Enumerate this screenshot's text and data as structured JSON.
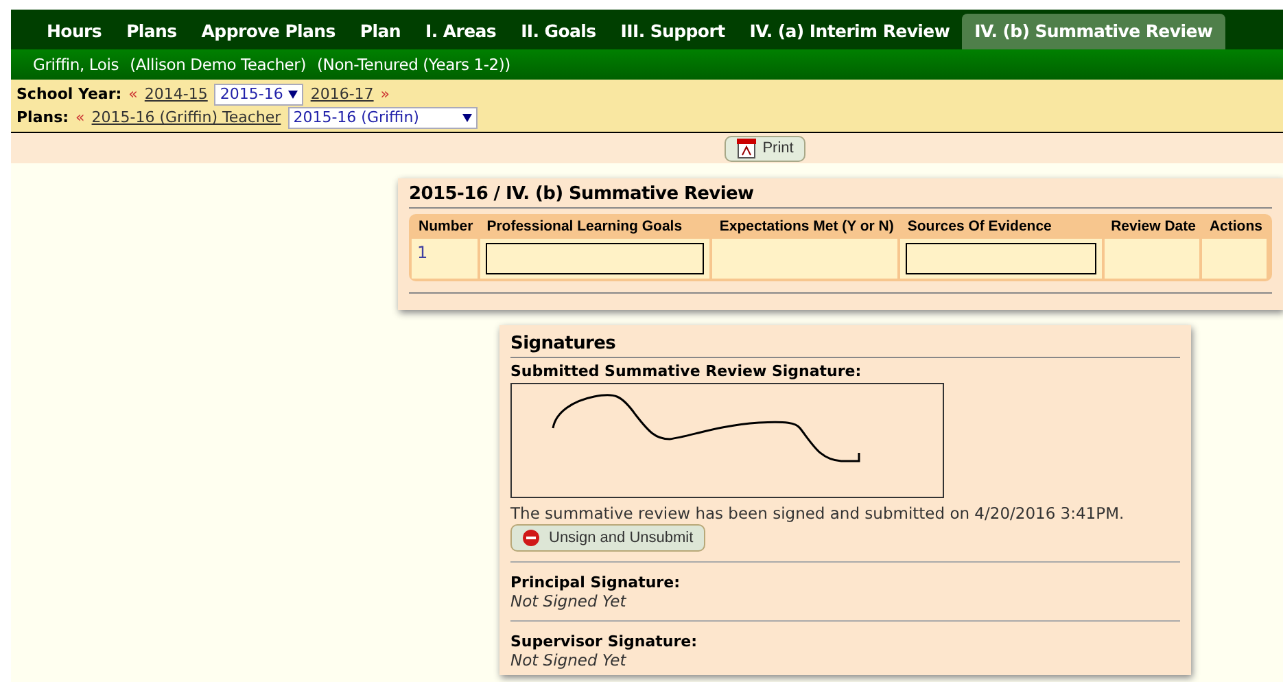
{
  "nav_tabs": [
    {
      "label": "Hours",
      "selected": false
    },
    {
      "label": "Plans",
      "selected": false
    },
    {
      "label": "Approve Plans",
      "selected": false
    },
    {
      "label": "Plan",
      "selected": false
    },
    {
      "label": "I. Areas",
      "selected": false
    },
    {
      "label": "II. Goals",
      "selected": false
    },
    {
      "label": "III. Support",
      "selected": false
    },
    {
      "label": "IV. (a) Interim Review",
      "selected": false
    },
    {
      "label": "IV. (b) Summative Review",
      "selected": true
    }
  ],
  "teacher_bar": {
    "name": "Griffin, Lois",
    "role": "(Allison Demo Teacher)",
    "status": "(Non-Tenured (Years 1-2))"
  },
  "school_year": {
    "label": "School Year:",
    "prev_arrow": "«",
    "prev": "2014-15",
    "select_value": "2015-16",
    "next": "2016-17",
    "next_arrow": "»"
  },
  "plans": {
    "label": "Plans:",
    "prev_arrow": "«",
    "prev": "2015-16 (Griffin) Teacher",
    "select_value": "2015-16 (Griffin)"
  },
  "print_button": "Print",
  "review": {
    "title": "2015-16 / IV. (b) Summative Review",
    "columns": [
      "Number",
      "Professional Learning Goals",
      "Expectations Met (Y or N)",
      "Sources Of Evidence",
      "Review Date",
      "Actions"
    ],
    "rows": [
      {
        "number": "1"
      }
    ]
  },
  "signatures": {
    "title": "Signatures",
    "submitted_label": "Submitted Summative Review Signature:",
    "submitted_text": "The summative review has been signed and submitted on 4/20/2016 3:41PM.",
    "unsign_button": "Unsign and Unsubmit",
    "others": [
      {
        "label": "Principal Signature:",
        "status": "Not Signed Yet"
      },
      {
        "label": "Supervisor Signature:",
        "status": "Not Signed Yet"
      }
    ]
  }
}
